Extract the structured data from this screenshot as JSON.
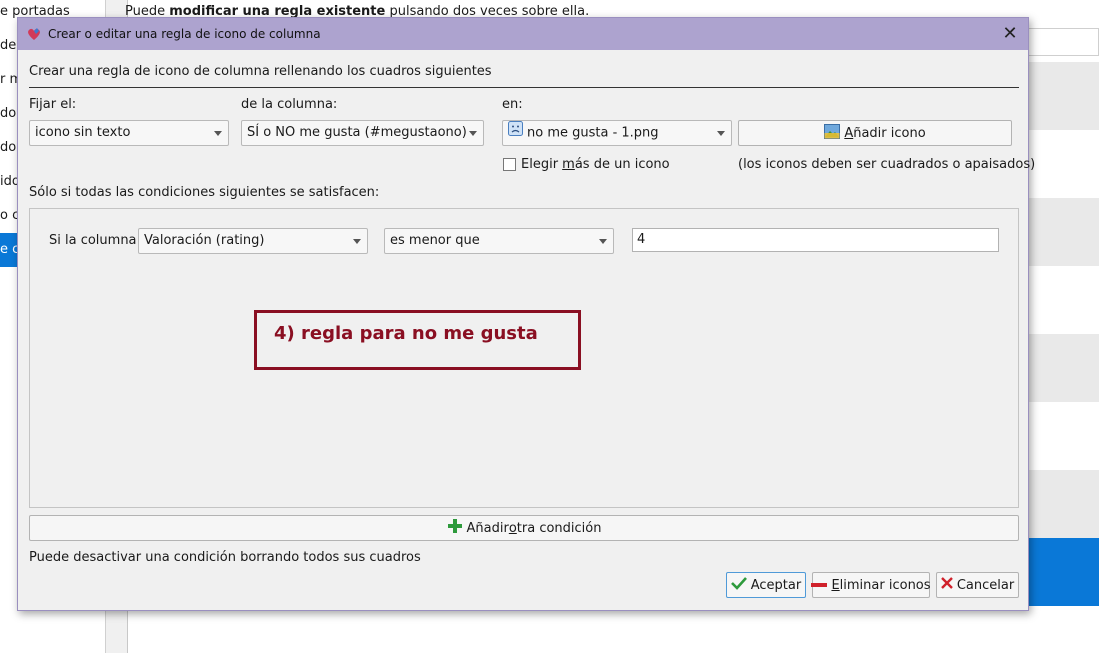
{
  "background": {
    "left_items": [
      {
        "text": "e portadas",
        "selected": false
      },
      {
        "text": "del",
        "selected": false
      },
      {
        "text": "r m",
        "selected": false
      },
      {
        "text": "dor",
        "selected": false
      },
      {
        "text": "dor",
        "selected": false
      },
      {
        "text": "ido",
        "selected": false
      },
      {
        "text": "o c",
        "selected": false
      },
      {
        "text": "e c",
        "selected": true
      }
    ],
    "hint_prefix": "Puede ",
    "hint_bold": "modificar una regla existente",
    "hint_suffix": " pulsando dos veces sobre ella."
  },
  "dialog": {
    "title": "Crear o editar una regla de icono de columna",
    "heading": "Crear una regla de icono de columna rellenando los cuadros siguientes",
    "set_label": "Fijar el:",
    "set_value": "icono sin texto",
    "column_label": "de la columna:",
    "column_value": "SÍ o NO me gusta (#megustaono)",
    "in_label": "en:",
    "in_value": "no me gusta - 1.png",
    "add_icon_prefix": "",
    "add_icon_u": "A",
    "add_icon_rest": "ñadir icono",
    "multi_icon_prefix": "Elegir ",
    "multi_icon_u": "m",
    "multi_icon_rest": "ás de un icono",
    "multi_icon_checked": false,
    "icons_note": "(los iconos deben ser cuadrados o apaisados)",
    "conditions_label": "Sólo si todas las condiciones siguientes se satisfacen:",
    "condition": {
      "if_label": "Si la columna",
      "column": "Valoración (rating)",
      "operator": "es menor que",
      "value": "4"
    },
    "annotation": "4) regla para no me gusta",
    "add_condition_prefix": "Añadir ",
    "add_condition_u": "o",
    "add_condition_rest": "tra condición",
    "disable_hint": "Puede desactivar una condición borrando todos sus cuadros",
    "accept": "Aceptar",
    "remove_icons_u": "E",
    "remove_icons_rest": "liminar iconos",
    "cancel": "Cancelar"
  },
  "colors": {
    "titlebar": "#ada3cf",
    "selection": "#0a78d7",
    "annotation": "#8a0f22",
    "add_green": "#2e9a3c",
    "remove_red": "#d0212b"
  }
}
